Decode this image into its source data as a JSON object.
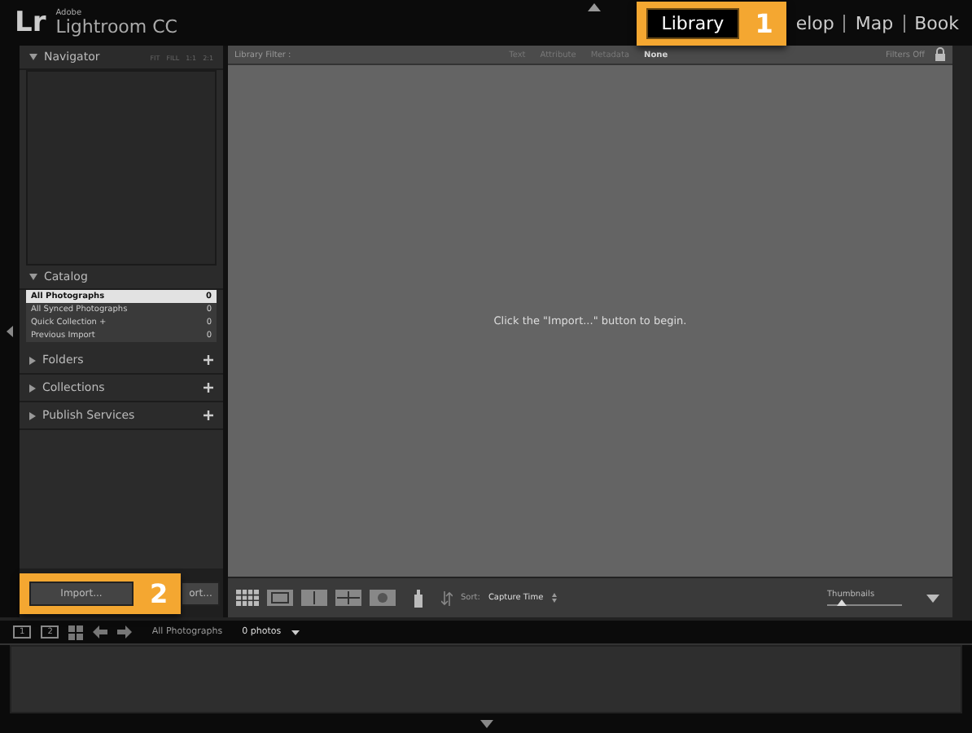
{
  "brand": {
    "logo": "Lr",
    "company": "Adobe",
    "product": "Lightroom CC"
  },
  "modules": [
    {
      "label": "Library",
      "selected": true,
      "callout": "1"
    },
    {
      "label": "elop",
      "selected": false
    },
    {
      "label": "Map",
      "selected": false
    },
    {
      "label": "Book",
      "selected": false
    }
  ],
  "navigator": {
    "title": "Navigator",
    "zoom": [
      "FIT",
      "FILL",
      "1:1",
      "2:1"
    ]
  },
  "catalog": {
    "title": "Catalog",
    "items": [
      {
        "label": "All Photographs",
        "count": "0",
        "selected": true
      },
      {
        "label": "All Synced Photographs",
        "count": "0",
        "selected": false
      },
      {
        "label": "Quick Collection +",
        "count": "0",
        "selected": false
      },
      {
        "label": "Previous Import",
        "count": "0",
        "selected": false
      }
    ]
  },
  "panels": [
    {
      "title": "Folders"
    },
    {
      "title": "Collections"
    },
    {
      "title": "Publish Services"
    }
  ],
  "filter": {
    "title": "Library Filter :",
    "tabs": [
      {
        "label": "Text",
        "selected": false
      },
      {
        "label": "Attribute",
        "selected": false
      },
      {
        "label": "Metadata",
        "selected": false
      },
      {
        "label": "None",
        "selected": true
      }
    ],
    "status": "Filters Off"
  },
  "message": "Click the \"Import...\" button to begin.",
  "import_button": {
    "label": "Import...",
    "callout": "2"
  },
  "export_button": {
    "label": "ort..."
  },
  "toolbar": {
    "sort_label": "Sort:",
    "sort_value": "Capture Time",
    "thumbnails_label": "Thumbnails",
    "level": 0.2
  },
  "filmstrip": {
    "screens": [
      "1",
      "2"
    ],
    "source": "All Photographs",
    "count": "0 photos"
  }
}
